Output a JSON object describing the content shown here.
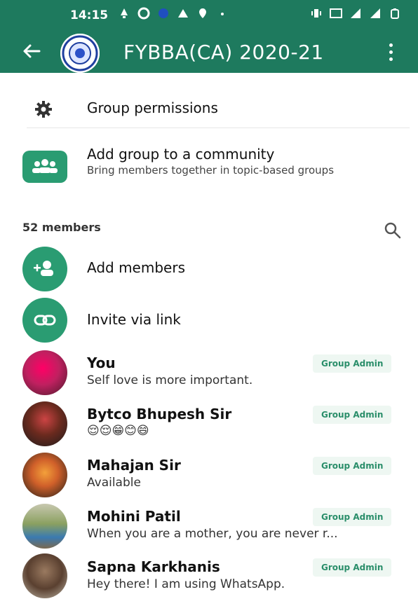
{
  "status_bar": {
    "time": "14:15"
  },
  "app_bar": {
    "title": "FYBBA(CA) 2020-21"
  },
  "group_permissions": {
    "label": "Group permissions"
  },
  "community": {
    "title": "Add group to a community",
    "subtitle": "Bring members together in topic-based groups"
  },
  "members_header": {
    "count_label": "52 members"
  },
  "actions": {
    "add_members": "Add members",
    "invite_via_link": "Invite via link"
  },
  "members": [
    {
      "name": "You",
      "status": "Self love is more important.",
      "badge": "Group Admin"
    },
    {
      "name": "Bytco Bhupesh Sir",
      "status": "😌😌😁😊😄",
      "badge": "Group Admin"
    },
    {
      "name": "Mahajan Sir",
      "status": "Available",
      "badge": "Group Admin"
    },
    {
      "name": "Mohini Patil",
      "status": "When you are a mother, you are never r...",
      "badge": "Group Admin"
    },
    {
      "name": "Sapna Karkhanis",
      "status": "Hey there! I am using WhatsApp.",
      "badge": "Group Admin"
    }
  ],
  "colors": {
    "header": "#1e7a5e",
    "accent": "#2a9c72",
    "badge_text": "#2a8e6a"
  }
}
